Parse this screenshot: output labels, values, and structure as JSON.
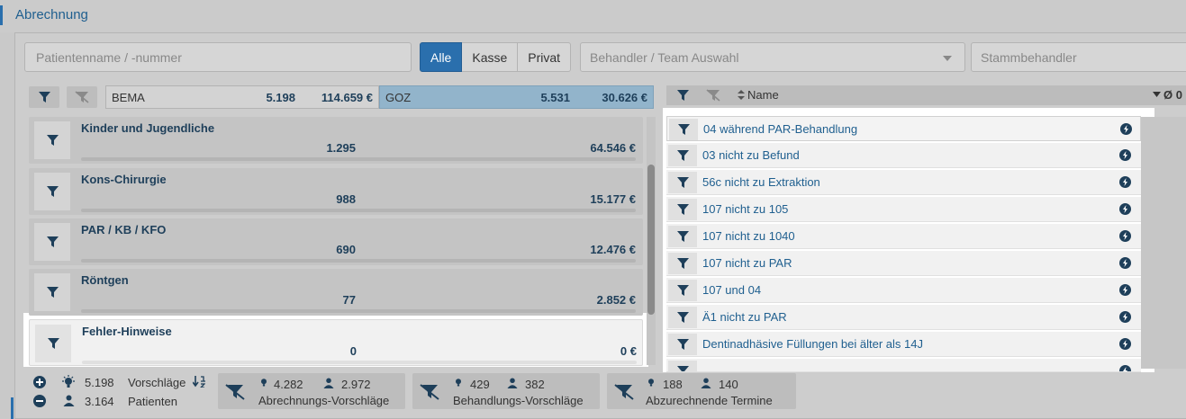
{
  "title": "Abrechnung",
  "filters": {
    "search_placeholder": "Patientenname / -nummer",
    "segments": [
      "Alle",
      "Kasse",
      "Privat"
    ],
    "active_segment": "Alle",
    "behandler_placeholder": "Behandler / Team Auswahl",
    "stammbehandler_placeholder": "Stammbehandler"
  },
  "summary": {
    "bema": {
      "label": "BEMA",
      "count": "5.198",
      "amount": "114.659 €"
    },
    "goz": {
      "label": "GOZ",
      "count": "5.531",
      "amount": "30.626 €"
    }
  },
  "categories": [
    {
      "name": "Kinder und Jugendliche",
      "count": "1.295",
      "amount": "64.546 €"
    },
    {
      "name": "Kons-Chirurgie",
      "count": "988",
      "amount": "15.177 €"
    },
    {
      "name": "PAR / KB / KFO",
      "count": "690",
      "amount": "12.476 €"
    },
    {
      "name": "Röntgen",
      "count": "77",
      "amount": "2.852 €"
    },
    {
      "name": "Fehler-Hinweise",
      "count": "0",
      "amount": "0 €"
    }
  ],
  "right_header": {
    "name_label": "Name",
    "avg_label": "Ø 0"
  },
  "hints": [
    "04 während PAR-Behandlung",
    "03 nicht zu Befund",
    "56c nicht zu Extraktion",
    "107 nicht zu 105",
    "107 nicht zu 1040",
    "107 nicht zu PAR",
    "107 und 04",
    "Ä1 nicht zu PAR",
    "Dentinadhäsive Füllungen bei älter als 14J"
  ],
  "bottom": {
    "vorschlaege_count": "5.198",
    "vorschlaege_label": "Vorschläge",
    "patienten_count": "3.164",
    "patienten_label": "Patienten",
    "cards": [
      {
        "idea": "4.282",
        "persons": "2.972",
        "label": "Abrechnungs-Vorschläge"
      },
      {
        "idea": "429",
        "persons": "382",
        "label": "Behandlungs-Vorschläge"
      },
      {
        "idea": "188",
        "persons": "140",
        "label": "Abzurechnende Termine"
      }
    ]
  },
  "colors": {
    "accent": "#2a6fad",
    "text_dark": "#1e3f5a",
    "goz_bg": "#92b4cb"
  }
}
